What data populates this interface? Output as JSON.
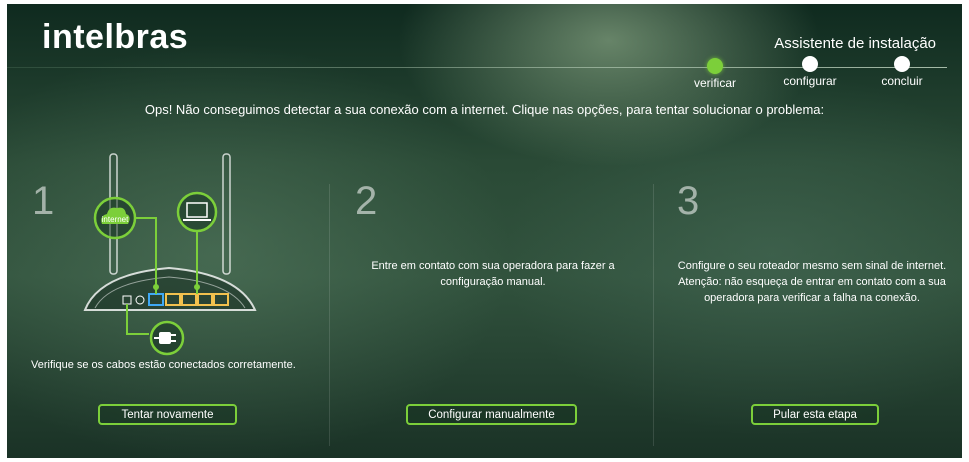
{
  "header": {
    "logo": "intelbras",
    "wizard_title": "Assistente de instalação",
    "steps": [
      {
        "label": "verificar",
        "active": true
      },
      {
        "label": "configurar",
        "active": false
      },
      {
        "label": "concluir",
        "active": false
      }
    ]
  },
  "message": "Ops! Não conseguimos detectar a sua conexão com a internet. Clique nas opções, para tentar solucionar o problema:",
  "columns": [
    {
      "number": "1",
      "text": "Verifique se os cabos estão conectados corretamente.",
      "button": "Tentar novamente",
      "illustration": {
        "internet_label": "internet"
      }
    },
    {
      "number": "2",
      "text_lines": [
        "Entre em contato com sua operadora para fazer a",
        "configuração manual."
      ],
      "button": "Configurar manualmente"
    },
    {
      "number": "3",
      "text_lines": [
        "Configure o seu roteador mesmo sem sinal de internet.",
        "Atenção: não esqueça de entrar em contato com a sua",
        "operadora para verificar a falha na conexão."
      ],
      "button": "Pular esta etapa"
    }
  ],
  "colors": {
    "accent": "#7ccf3a",
    "text": "#ffffff"
  }
}
